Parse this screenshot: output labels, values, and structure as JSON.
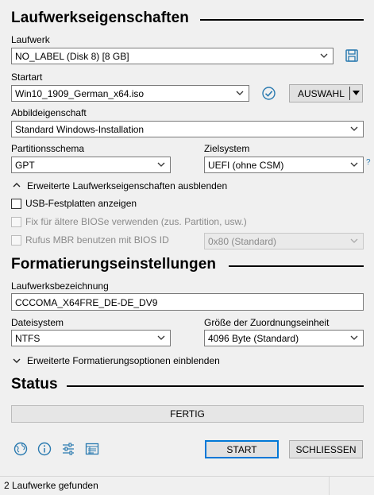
{
  "drive_properties": {
    "title": "Laufwerkseigenschaften",
    "device_label": "Laufwerk",
    "device_value": "NO_LABEL (Disk 8) [8 GB]",
    "boot_selection_label": "Startart",
    "boot_selection_value": "Win10_1909_German_x64.iso",
    "select_button": "AUSWAHL",
    "image_option_label": "Abbildeigenschaft",
    "image_option_value": "Standard Windows-Installation",
    "partition_scheme_label": "Partitionsschema",
    "partition_scheme_value": "GPT",
    "target_system_label": "Zielsystem",
    "target_system_value": "UEFI (ohne CSM)",
    "help_mark": "?",
    "advanced_toggle": "Erweiterte Laufwerkseigenschaften ausblenden",
    "list_usb_hdd": "USB-Festplatten anzeigen",
    "old_bios_fix": "Fix für ältere BIOSe verwenden (zus. Partition, usw.)",
    "rufus_mbr": "Rufus MBR benutzen mit BIOS ID",
    "bios_id_value": "0x80 (Standard)"
  },
  "format_options": {
    "title": "Formatierungseinstellungen",
    "volume_label_label": "Laufwerksbezeichnung",
    "volume_label_value": "CCCOMA_X64FRE_DE-DE_DV9",
    "file_system_label": "Dateisystem",
    "file_system_value": "NTFS",
    "cluster_size_label": "Größe der Zuordnungseinheit",
    "cluster_size_value": "4096 Byte (Standard)",
    "advanced_toggle": "Erweiterte Formatierungsoptionen einblenden"
  },
  "status": {
    "title": "Status",
    "progress_text": "FERTIG",
    "progress_fraction": 1.0
  },
  "footer": {
    "start_button": "START",
    "close_button": "SCHLIESSEN",
    "status_bar_text": "2 Laufwerke gefunden"
  },
  "colors": {
    "accent": "#0078d7",
    "window_bg": "#f0f0f0",
    "icon_blue": "#2a7ab0"
  }
}
